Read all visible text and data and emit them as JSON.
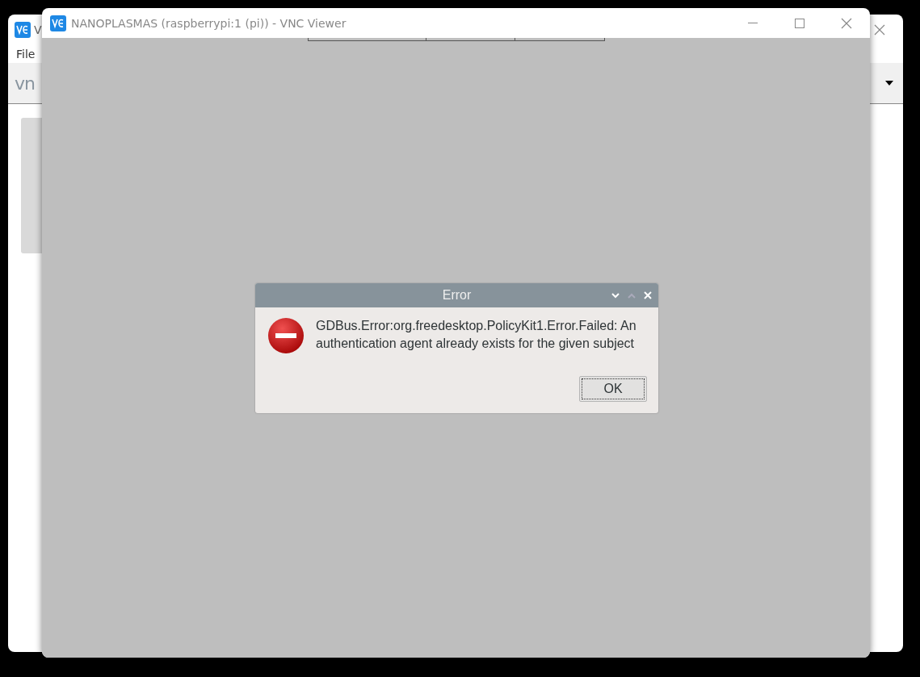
{
  "back_window": {
    "title": "V",
    "menu": [
      "File"
    ],
    "logo_text": "vn"
  },
  "front_window": {
    "title": "NANOPLASMAS (raspberrypi:1 (pi)) - VNC Viewer"
  },
  "dialog": {
    "title": "Error",
    "message": "GDBus.Error:org.freedesktop.PolicyKit1.Error.Failed: An authentication agent already exists for the given subject",
    "buttons": [
      {
        "label": "OK",
        "focused": true
      }
    ]
  }
}
